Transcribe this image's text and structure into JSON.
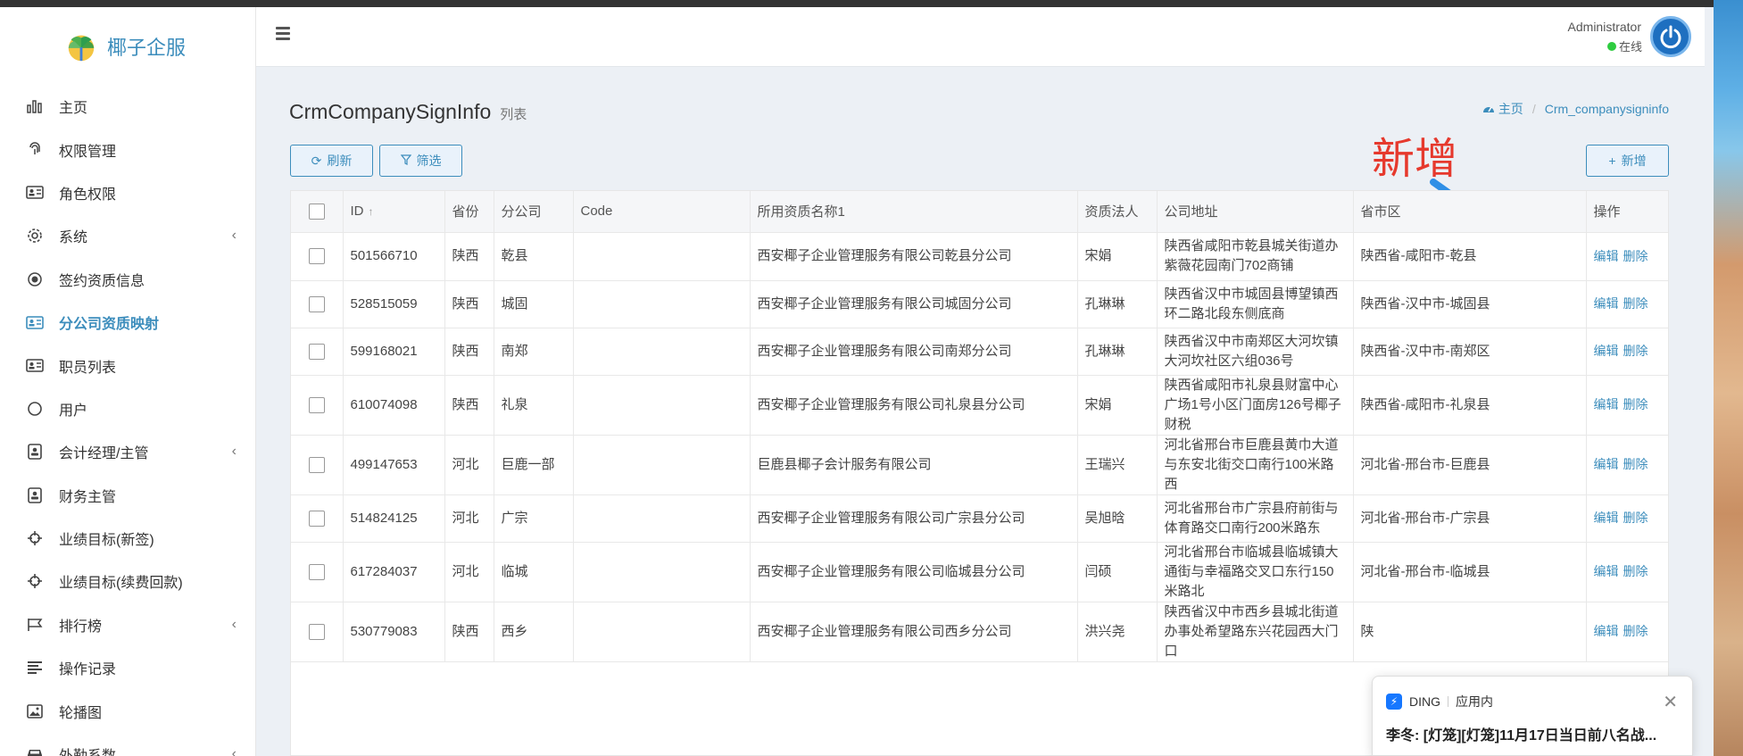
{
  "app": {
    "name": "椰子企服",
    "brand_color": "#3c8dbc"
  },
  "sidebar": {
    "items": [
      {
        "label": "主页",
        "icon": "bar-chart-icon",
        "active": false,
        "has_submenu": false
      },
      {
        "label": "权限管理",
        "icon": "fingerprint-icon",
        "active": false,
        "has_submenu": false
      },
      {
        "label": "角色权限",
        "icon": "id-card-icon",
        "active": false,
        "has_submenu": false
      },
      {
        "label": "系统",
        "icon": "gear-icon",
        "active": false,
        "has_submenu": true
      },
      {
        "label": "签约资质信息",
        "icon": "target-icon",
        "active": false,
        "has_submenu": false
      },
      {
        "label": "分公司资质映射",
        "icon": "id-card-icon",
        "active": true,
        "has_submenu": false
      },
      {
        "label": "职员列表",
        "icon": "id-card-icon",
        "active": false,
        "has_submenu": false
      },
      {
        "label": "用户",
        "icon": "circle-icon",
        "active": false,
        "has_submenu": false
      },
      {
        "label": "会计经理/主管",
        "icon": "user-badge-icon",
        "active": false,
        "has_submenu": true
      },
      {
        "label": "财务主管",
        "icon": "user-badge-icon",
        "active": false,
        "has_submenu": false
      },
      {
        "label": "业绩目标(新签)",
        "icon": "crosshair-icon",
        "active": false,
        "has_submenu": false
      },
      {
        "label": "业绩目标(续费回款)",
        "icon": "crosshair-icon",
        "active": false,
        "has_submenu": false
      },
      {
        "label": "排行榜",
        "icon": "flag-icon",
        "active": false,
        "has_submenu": true
      },
      {
        "label": "操作记录",
        "icon": "align-left-icon",
        "active": false,
        "has_submenu": false
      },
      {
        "label": "轮播图",
        "icon": "image-icon",
        "active": false,
        "has_submenu": false
      },
      {
        "label": "外勤系数",
        "icon": "car-icon",
        "active": false,
        "has_submenu": true
      }
    ]
  },
  "header": {
    "user_name": "Administrator",
    "status": "在线"
  },
  "page": {
    "title": "CrmCompanySignInfo",
    "subtitle": "列表",
    "breadcrumb": {
      "home": "主页",
      "current": "Crm_companysigninfo"
    },
    "toolbar": {
      "refresh": "刷新",
      "filter": "筛选",
      "add": "新增"
    },
    "annotation": "新增"
  },
  "table": {
    "columns": [
      "ID",
      "省份",
      "分公司",
      "Code",
      "所用资质名称1",
      "资质法人",
      "公司地址",
      "省市区",
      "操作"
    ],
    "actions": {
      "edit": "编辑",
      "delete": "删除"
    },
    "rows": [
      {
        "id": "501566710",
        "province": "陕西",
        "branch": "乾县",
        "code": "",
        "qualification": "西安椰子企业管理服务有限公司乾县分公司",
        "legal": "宋娟",
        "address": "陕西省咸阳市乾县城关街道办紫薇花园南门702商铺",
        "region": "陕西省-咸阳市-乾县"
      },
      {
        "id": "528515059",
        "province": "陕西",
        "branch": "城固",
        "code": "",
        "qualification": "西安椰子企业管理服务有限公司城固分公司",
        "legal": "孔琳琳",
        "address": "陕西省汉中市城固县博望镇西环二路北段东侧底商",
        "region": "陕西省-汉中市-城固县"
      },
      {
        "id": "599168021",
        "province": "陕西",
        "branch": "南郑",
        "code": "",
        "qualification": "西安椰子企业管理服务有限公司南郑分公司",
        "legal": "孔琳琳",
        "address": "陕西省汉中市南郑区大河坎镇大河坎社区六组036号",
        "region": "陕西省-汉中市-南郑区"
      },
      {
        "id": "610074098",
        "province": "陕西",
        "branch": "礼泉",
        "code": "",
        "qualification": "西安椰子企业管理服务有限公司礼泉县分公司",
        "legal": "宋娟",
        "address": "陕西省咸阳市礼泉县财富中心广场1号小区门面房126号椰子财税",
        "region": "陕西省-咸阳市-礼泉县"
      },
      {
        "id": "499147653",
        "province": "河北",
        "branch": "巨鹿一部",
        "code": "",
        "qualification": "巨鹿县椰子会计服务有限公司",
        "legal": "王瑞兴",
        "address": "河北省邢台市巨鹿县黄巾大道与东安北街交口南行100米路西",
        "region": "河北省-邢台市-巨鹿县"
      },
      {
        "id": "514824125",
        "province": "河北",
        "branch": "广宗",
        "code": "",
        "qualification": "西安椰子企业管理服务有限公司广宗县分公司",
        "legal": "吴旭晗",
        "address": "河北省邢台市广宗县府前街与体育路交口南行200米路东",
        "region": "河北省-邢台市-广宗县"
      },
      {
        "id": "617284037",
        "province": "河北",
        "branch": "临城",
        "code": "",
        "qualification": "西安椰子企业管理服务有限公司临城县分公司",
        "legal": "闫硕",
        "address": "河北省邢台市临城县临城镇大通街与幸福路交叉口东行150米路北",
        "region": "河北省-邢台市-临城县"
      },
      {
        "id": "530779083",
        "province": "陕西",
        "branch": "西乡",
        "code": "",
        "qualification": "西安椰子企业管理服务有限公司西乡分公司",
        "legal": "洪兴尧",
        "address": "陕西省汉中市西乡县城北街道办事处希望路东兴花园西大门口",
        "region": "陕"
      }
    ]
  },
  "notification": {
    "app": "DING",
    "scope": "应用内",
    "message": "李冬: [灯笼][灯笼]11月17日当日前八名战..."
  }
}
